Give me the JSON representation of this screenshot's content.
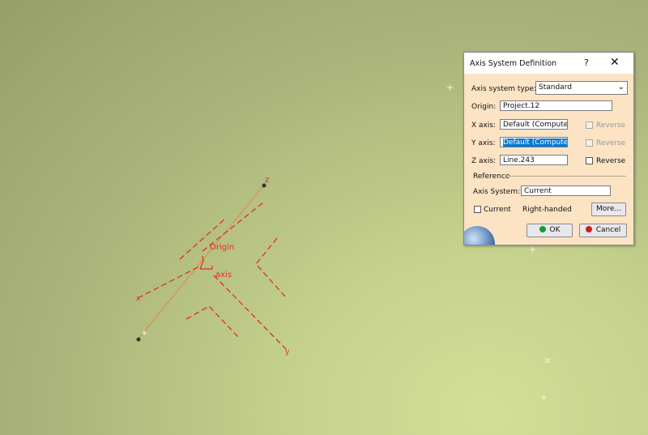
{
  "viewport": {
    "labels": {
      "z": "z",
      "origin": "Origin",
      "axis": "axis",
      "x": "x",
      "y": "y"
    },
    "colors": {
      "axis_red": "#e0301e",
      "line_orange": "#e08a3a",
      "background": "#b6c07f"
    }
  },
  "dialog": {
    "title": "Axis System Definition",
    "help_label": "?",
    "close_label": "✕",
    "axis_system_type_label": "Axis system type:",
    "axis_system_type_value": "Standard",
    "origin_label": "Origin:",
    "origin_value": "Project.12",
    "x_axis_label": "X axis:",
    "x_axis_value": "Default (Computed)",
    "x_reverse_label": "Reverse",
    "y_axis_label": "Y axis:",
    "y_axis_value": "Default (Computed)",
    "y_reverse_label": "Reverse",
    "z_axis_label": "Z axis:",
    "z_axis_value": "Line.243",
    "z_reverse_label": "Reverse",
    "reference_label": "Reference",
    "axis_system_label": "Axis System:",
    "axis_system_value": "Current",
    "current_label": "Current",
    "handedness": "Right-handed",
    "more_button": "More...",
    "ok_button": "OK",
    "cancel_button": "Cancel",
    "colors": {
      "ok_dot": "#1a9a35",
      "cancel_dot": "#d11f1f",
      "selection": "#0078d7"
    }
  }
}
